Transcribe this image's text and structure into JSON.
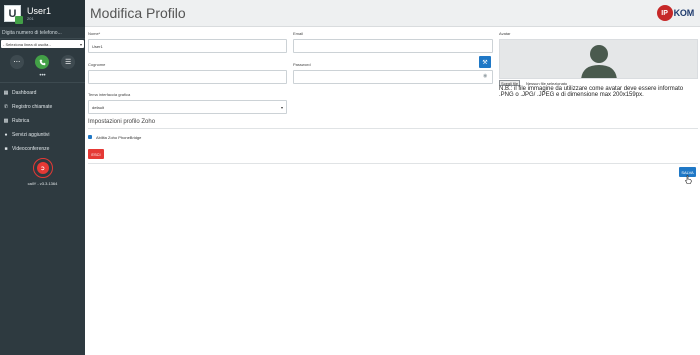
{
  "sidebar": {
    "user": {
      "initial": "U",
      "name": "User1",
      "extension": "201"
    },
    "phone_placeholder": "Digita numero di telefono...",
    "line_select": "- Seleziona linea di uscita -",
    "nav": [
      {
        "label": "Dashboard",
        "icon": "dashboard-icon"
      },
      {
        "label": "Registro chiamate",
        "icon": "phone-icon"
      },
      {
        "label": "Rubrica",
        "icon": "book-icon"
      },
      {
        "label": "Servizi aggiuntivi",
        "icon": "users-icon"
      },
      {
        "label": "Videoconferenze",
        "icon": "video-icon"
      }
    ],
    "version": "callY - v3.3.1364"
  },
  "header": {
    "title": "Modifica Profilo",
    "logo_ip": "IP",
    "logo_kom": "KOM"
  },
  "form": {
    "name": {
      "label": "Nome*",
      "value": "User1"
    },
    "surname": {
      "label": "Cognome",
      "value": ""
    },
    "email": {
      "label": "Email",
      "value": ""
    },
    "password": {
      "label": "Password",
      "value": ""
    },
    "theme": {
      "label": "Tema interfaccia grafica",
      "value": "default"
    },
    "avatar": {
      "label": "Avatar",
      "file_button": "Scegli file",
      "file_status": "Nessun file selezionato",
      "note": "N.B.: il file immagine da utilizzare come avatar deve essere informato .PNG o .JPG/ .JPEG e di dimensione max 200x159px."
    },
    "zoho": {
      "section_title": "Impostazioni profilo Zoho",
      "checkbox_label": "Abilita Zoho PhoneBridge",
      "checked": true
    },
    "exit_label": "ESCI",
    "save_label": "SALVA"
  },
  "colors": {
    "sidebar": "#2e3a40",
    "accent": "#1f78c6",
    "danger": "#e53935",
    "call": "#43a047"
  }
}
